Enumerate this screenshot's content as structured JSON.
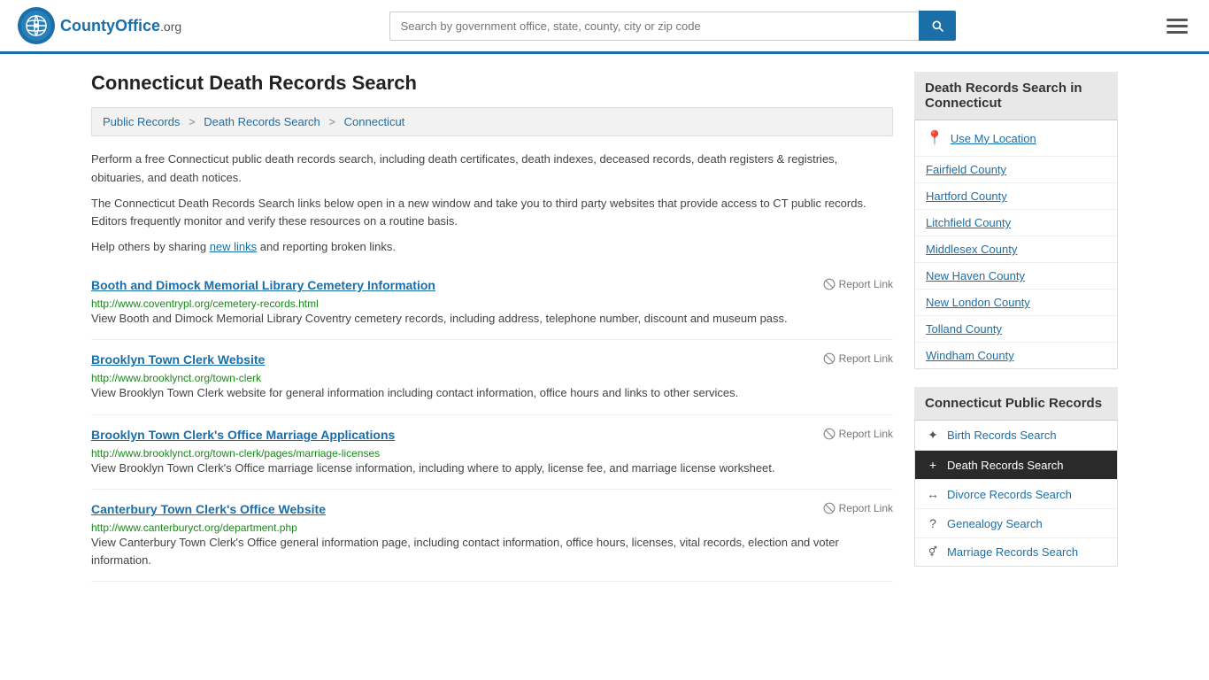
{
  "header": {
    "logo_text": "CountyOffice",
    "logo_suffix": ".org",
    "search_placeholder": "Search by government office, state, county, city or zip code",
    "search_value": ""
  },
  "page": {
    "title": "Connecticut Death Records Search",
    "breadcrumb": [
      {
        "label": "Public Records",
        "href": "#"
      },
      {
        "label": "Death Records Search",
        "href": "#"
      },
      {
        "label": "Connecticut",
        "href": "#"
      }
    ],
    "description1": "Perform a free Connecticut public death records search, including death certificates, death indexes, deceased records, death registers & registries, obituaries, and death notices.",
    "description2": "The Connecticut Death Records Search links below open in a new window and take you to third party websites that provide access to CT public records. Editors frequently monitor and verify these resources on a routine basis.",
    "description3_prefix": "Help others by sharing ",
    "description3_link": "new links",
    "description3_suffix": " and reporting broken links."
  },
  "results": [
    {
      "title": "Booth and Dimock Memorial Library Cemetery Information",
      "url": "http://www.coventrypl.org/cemetery-records.html",
      "desc": "View Booth and Dimock Memorial Library Coventry cemetery records, including address, telephone number, discount and museum pass.",
      "report": "Report Link"
    },
    {
      "title": "Brooklyn Town Clerk Website",
      "url": "http://www.brooklynct.org/town-clerk",
      "desc": "View Brooklyn Town Clerk website for general information including contact information, office hours and links to other services.",
      "report": "Report Link"
    },
    {
      "title": "Brooklyn Town Clerk's Office Marriage Applications",
      "url": "http://www.brooklynct.org/town-clerk/pages/marriage-licenses",
      "desc": "View Brooklyn Town Clerk's Office marriage license information, including where to apply, license fee, and marriage license worksheet.",
      "report": "Report Link"
    },
    {
      "title": "Canterbury Town Clerk's Office Website",
      "url": "http://www.canterburyct.org/department.php",
      "desc": "View Canterbury Town Clerk's Office general information page, including contact information, office hours, licenses, vital records, election and voter information.",
      "report": "Report Link"
    }
  ],
  "sidebar": {
    "section1_title": "Death Records Search in Connecticut",
    "use_location_label": "Use My Location",
    "counties": [
      "Fairfield County",
      "Hartford County",
      "Litchfield County",
      "Middlesex County",
      "New Haven County",
      "New London County",
      "Tolland County",
      "Windham County"
    ],
    "section2_title": "Connecticut Public Records",
    "records_links": [
      {
        "label": "Birth Records Search",
        "icon": "✦",
        "active": false
      },
      {
        "label": "Death Records Search",
        "icon": "+",
        "active": true
      },
      {
        "label": "Divorce Records Search",
        "icon": "↔",
        "active": false
      },
      {
        "label": "Genealogy Search",
        "icon": "?",
        "active": false
      },
      {
        "label": "Marriage Records Search",
        "icon": "♀♂",
        "active": false
      }
    ]
  },
  "labels": {
    "report_link": "Report Link"
  }
}
